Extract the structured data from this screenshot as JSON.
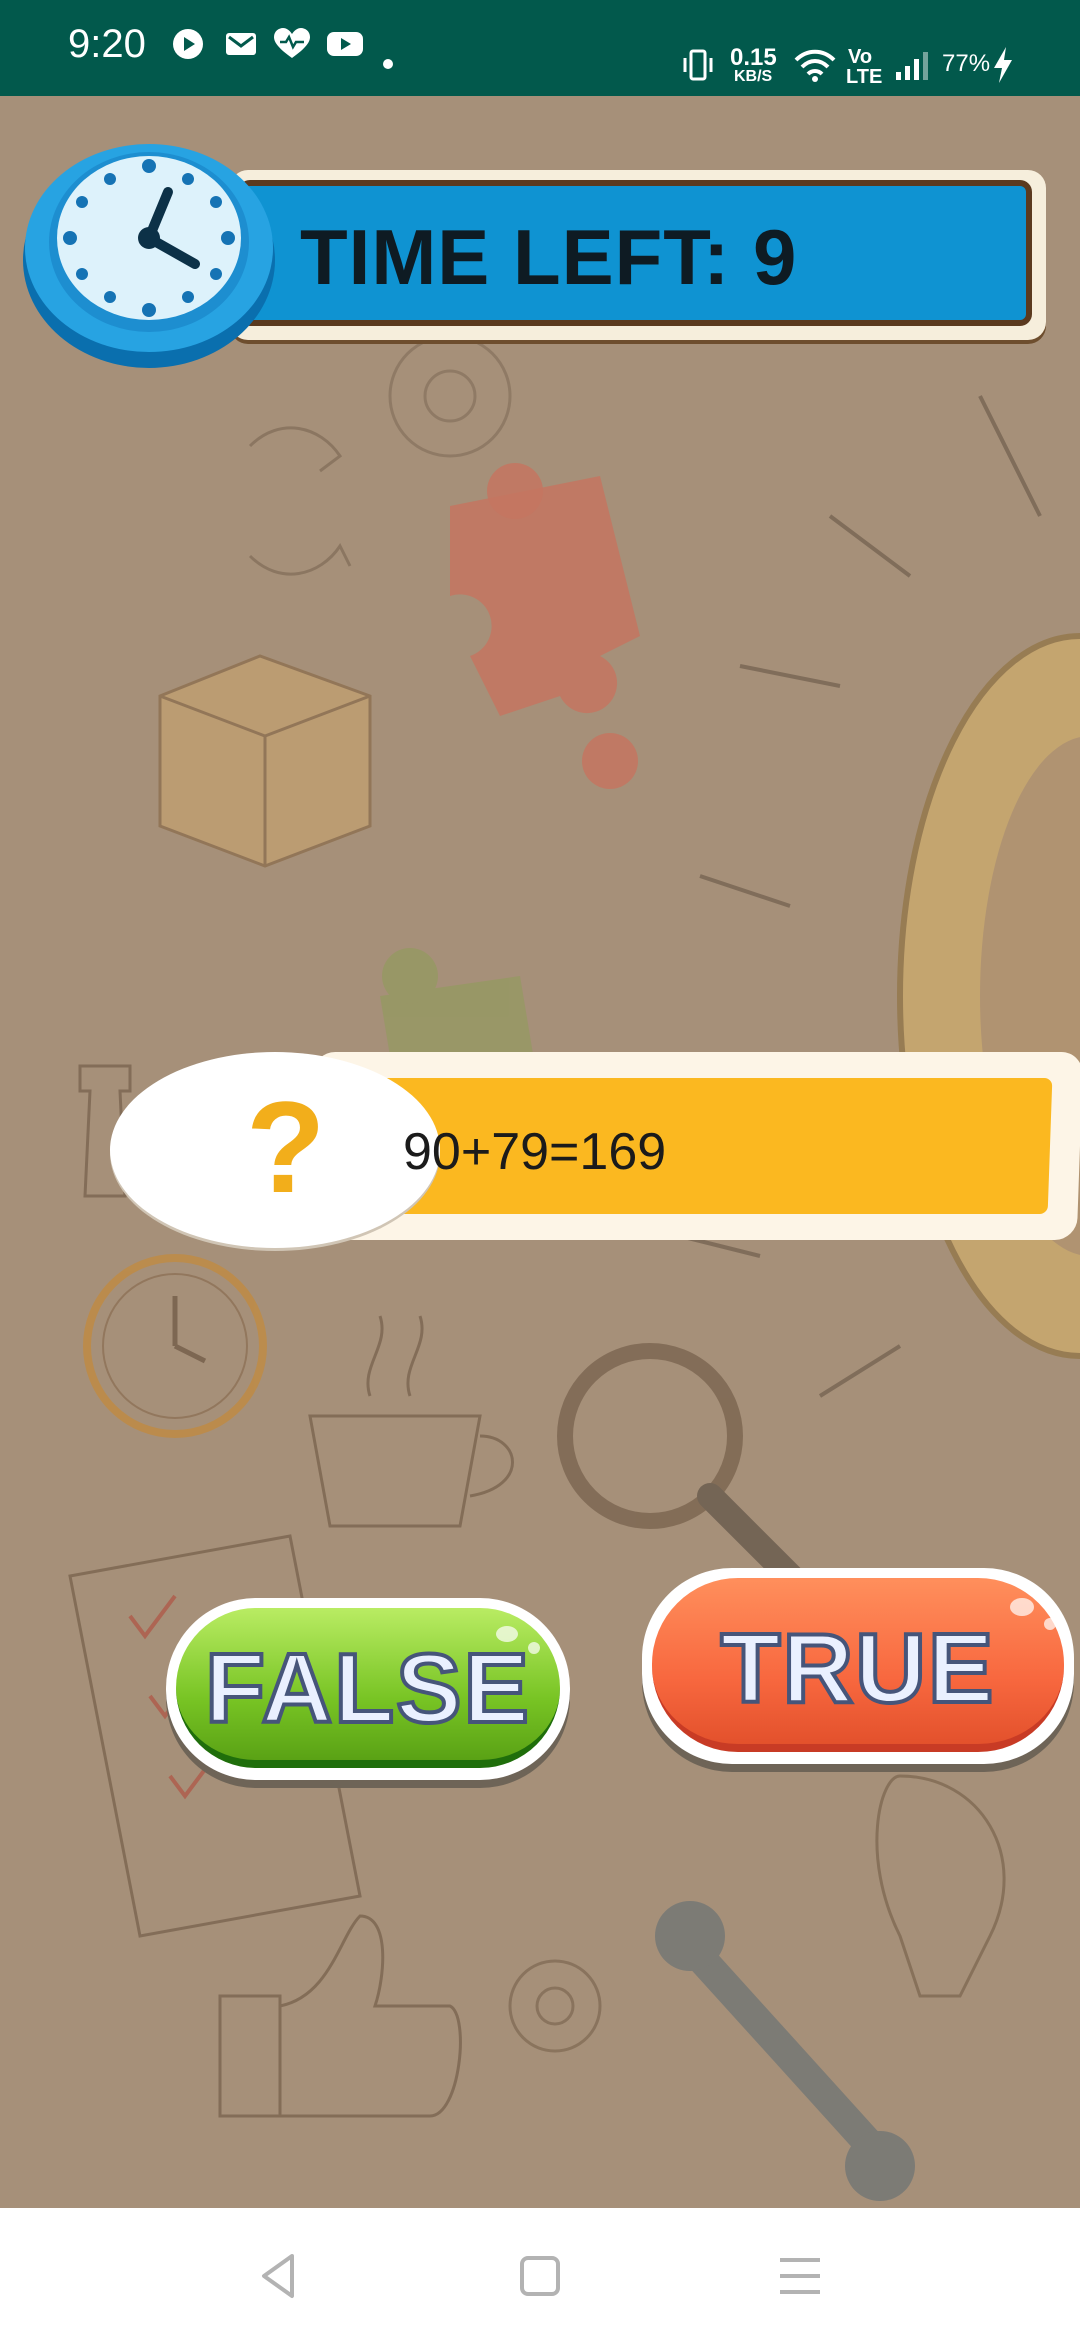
{
  "status_bar": {
    "time": "9:20",
    "net_speed_value": "0.15",
    "net_speed_unit": "KB/S",
    "volte_top": "Vo",
    "volte_bottom": "LTE",
    "battery_percent": "77%",
    "notification_icons": [
      "play-icon",
      "mail-icon",
      "heart-icon",
      "youtube-icon",
      "dot-icon"
    ],
    "system_icons": [
      "vibrate-icon",
      "wifi-icon",
      "signal-icon",
      "charging-icon"
    ]
  },
  "game": {
    "timer_label": "TIME LEFT: 9",
    "question_mark": "?",
    "question": "90+79=169",
    "false_label": "FALSE",
    "true_label": "TRUE"
  },
  "colors": {
    "status_bar": "#02594c",
    "background": "#a69079",
    "timer_bar": "#0f93d2",
    "question_bar": "#fbb820",
    "false_button": "#78c424",
    "true_button": "#f8683f"
  },
  "nav_bar": {
    "icons": [
      "back-icon",
      "home-icon",
      "menu-icon"
    ]
  }
}
